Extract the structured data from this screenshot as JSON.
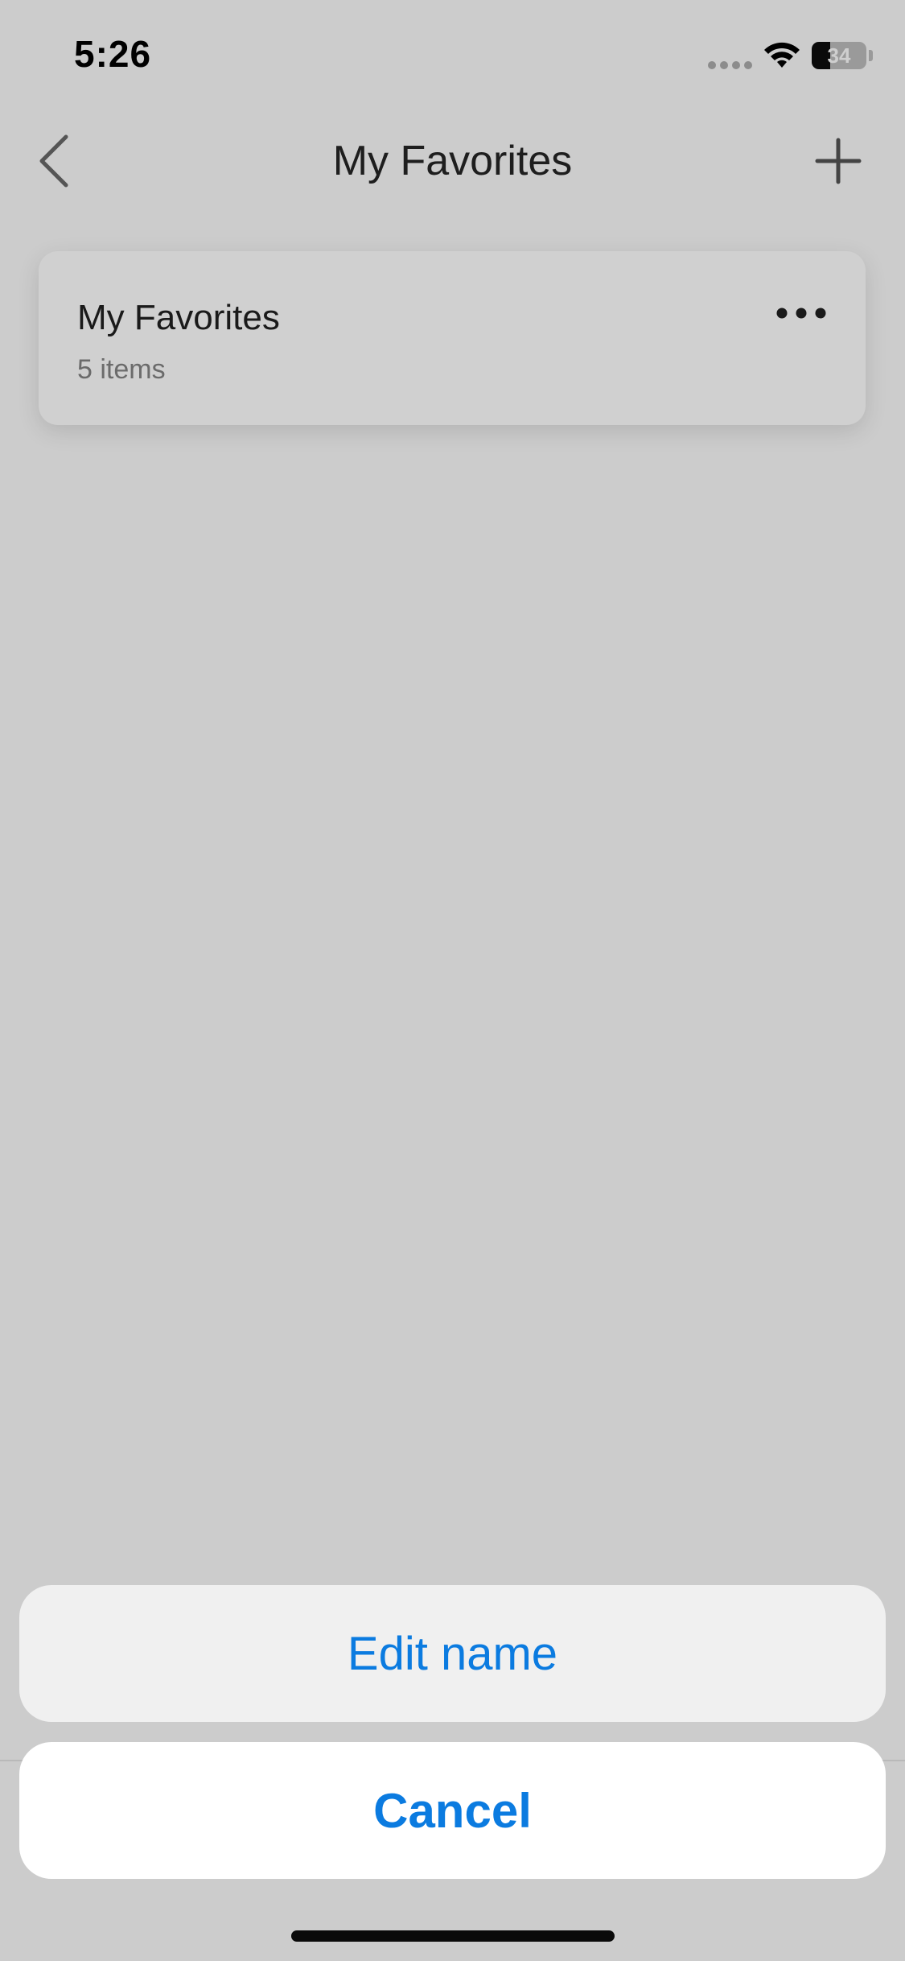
{
  "status_bar": {
    "time": "5:26",
    "battery_level": "34",
    "battery_fraction": 0.34,
    "icons": [
      "signal-icon",
      "wifi-icon",
      "battery-icon"
    ]
  },
  "nav": {
    "title": "My Favorites",
    "back_icon": "chevron-left-icon",
    "add_icon": "plus-icon"
  },
  "favorites_list": [
    {
      "title": "My Favorites",
      "subtitle": "5 items",
      "more_icon": "ellipsis-icon"
    }
  ],
  "action_sheet": {
    "edit_label": "Edit name",
    "cancel_label": "Cancel"
  },
  "colors": {
    "accent": "#0b7be0",
    "dimmed_background": "#cccccc",
    "sheet_background": "#f0f0f0",
    "cancel_background": "#ffffff"
  }
}
